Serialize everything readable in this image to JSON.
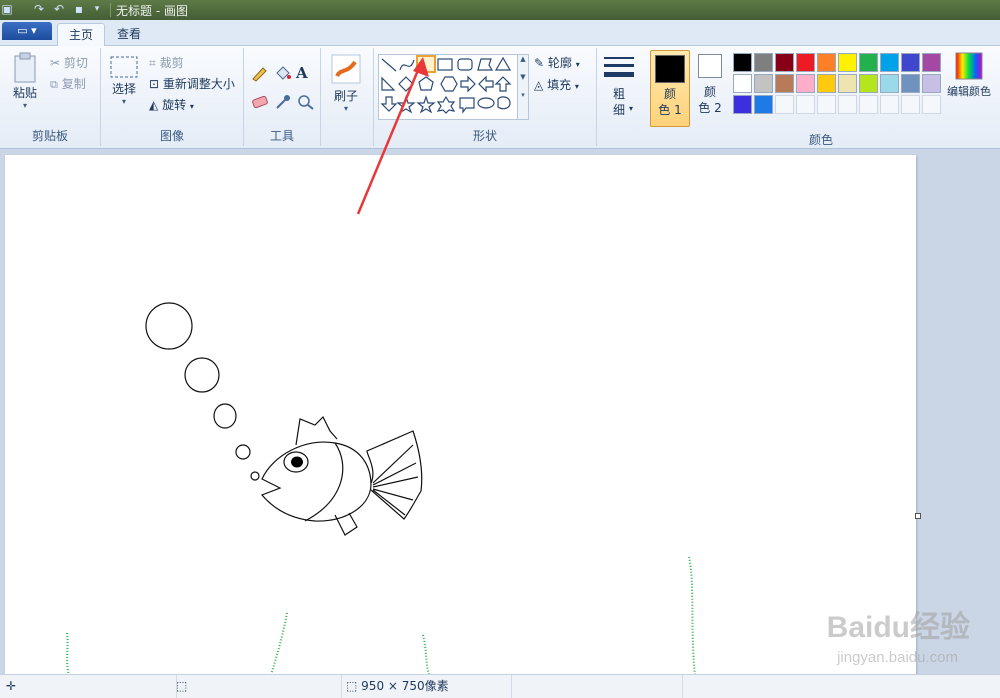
{
  "window": {
    "title": "无标题 - 画图"
  },
  "tabs": [
    {
      "label": "主页"
    },
    {
      "label": "查看"
    }
  ],
  "clipboard": {
    "paste": "粘贴",
    "cut": "剪切",
    "copy": "复制",
    "group": "剪贴板"
  },
  "image": {
    "select": "选择",
    "crop": "裁剪",
    "resize": "重新调整大小",
    "rotate": "旋转",
    "group": "图像"
  },
  "tools": {
    "group": "工具"
  },
  "brushes": {
    "label": "刷子"
  },
  "shapes": {
    "group": "形状",
    "outline": "轮廓",
    "fill": "填充"
  },
  "size": {
    "label_line1": "粗",
    "label_line2": "细"
  },
  "colors": {
    "color1_line1": "颜",
    "color1_line2": "色 1",
    "color2_line1": "颜",
    "color2_line2": "色 2",
    "edit": "编辑颜色",
    "group": "颜色",
    "color1_value": "#000000",
    "color2_value": "#ffffff",
    "palette_row1": [
      "#000000",
      "#7f7f7f",
      "#880015",
      "#ed1c24",
      "#ff7f27",
      "#fff200",
      "#22b14c",
      "#00a2e8",
      "#3f48cc",
      "#a349a4"
    ],
    "palette_row2": [
      "#ffffff",
      "#c3c3c3",
      "#b97a57",
      "#ffaec9",
      "#ffc90e",
      "#efe4b0",
      "#b5e61d",
      "#99d9ea",
      "#7092be",
      "#c8bfe7"
    ],
    "palette_row3": [
      "#3b2fe0",
      "#1e7ae6"
    ]
  },
  "status": {
    "size": "950 × 750像素"
  },
  "watermark": {
    "brand": "Baidu经验",
    "url": "jingyan.baidu.com"
  }
}
